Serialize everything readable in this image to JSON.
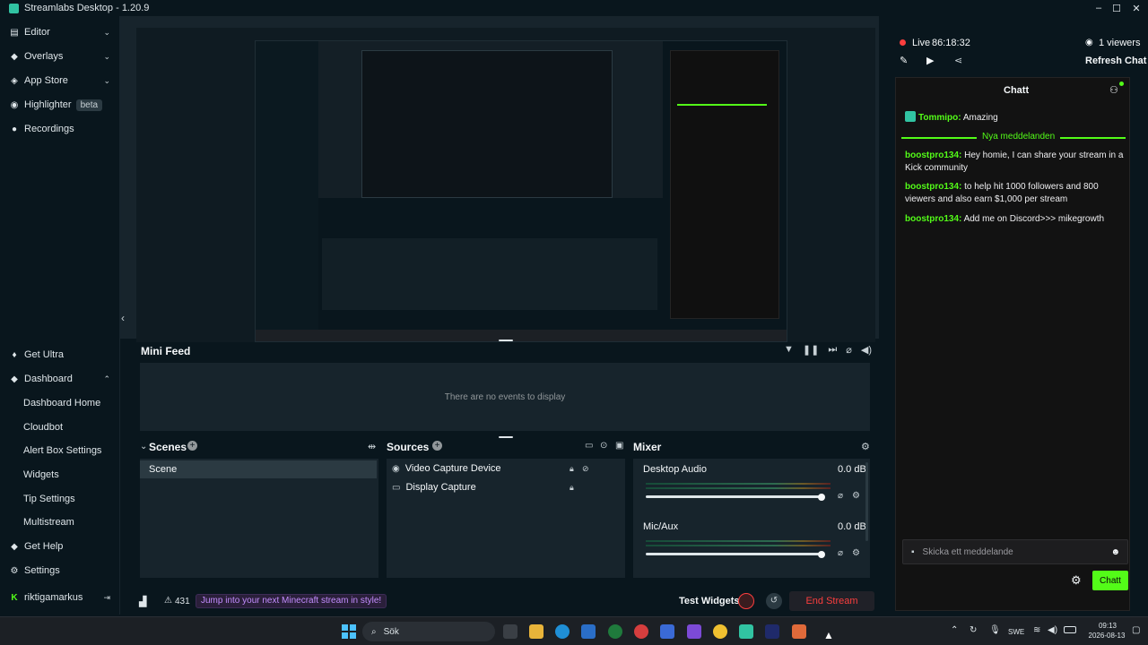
{
  "app": {
    "title": "Streamlabs Desktop - 1.20.9"
  },
  "sidebar": {
    "items": [
      {
        "label": "Editor"
      },
      {
        "label": "Overlays"
      },
      {
        "label": "App Store"
      },
      {
        "label": "Highlighter",
        "badge": "beta"
      },
      {
        "label": "Recordings"
      }
    ],
    "bottom": [
      {
        "label": "Get Ultra"
      },
      {
        "label": "Dashboard"
      },
      {
        "label": "Dashboard Home"
      },
      {
        "label": "Cloudbot"
      },
      {
        "label": "Alert Box Settings"
      },
      {
        "label": "Widgets"
      },
      {
        "label": "Tip Settings"
      },
      {
        "label": "Multistream"
      },
      {
        "label": "Get Help"
      },
      {
        "label": "Settings"
      }
    ],
    "user": "riktigamarkus"
  },
  "mini_feed": {
    "title": "Mini Feed",
    "empty_text": "There are no events to display"
  },
  "scenes": {
    "title": "Scenes",
    "items": [
      "Scene"
    ]
  },
  "sources": {
    "title": "Sources",
    "items": [
      "Video Capture Device",
      "Display Capture"
    ]
  },
  "mixer": {
    "title": "Mixer",
    "channels": [
      {
        "name": "Desktop Audio",
        "level": "0.0 dB",
        "volume": 1.0
      },
      {
        "name": "Mic/Aux",
        "level": "0.0 dB",
        "volume": 1.0
      }
    ]
  },
  "footer": {
    "alert_count": "431",
    "promo": "Jump into your next Minecraft stream in style!",
    "test_widgets": "Test Widgets",
    "end_stream": "End Stream"
  },
  "live": {
    "status": "Live",
    "timer": "86:18:32",
    "viewers": "1 viewers",
    "refresh_chat": "Refresh Chat"
  },
  "chat": {
    "title": "Chatt",
    "messages": [
      {
        "user": "Tommipo:",
        "text": "Amazing"
      },
      {
        "user": "boostpro134:",
        "text": "Hey homie, I can share your stream in a Kick community"
      },
      {
        "user": "boostpro134:",
        "text": "to help hit 1000 followers and 800 viewers and also earn $1,000 per stream"
      },
      {
        "user": "boostpro134:",
        "text": "Add me on Discord>>> mikegrowth"
      }
    ],
    "new_messages": "Nya meddelanden",
    "placeholder": "Skicka ett meddelande",
    "send": "Chatt"
  },
  "taskbar": {
    "search": "Sök",
    "lang": "SWE",
    "time": "09:13",
    "date": "2026-08-13"
  },
  "colors": {
    "accent": "#31c3a2",
    "kick_green": "#53fc18",
    "end_stream": "#fc3e3e",
    "panel": "#17242c"
  }
}
